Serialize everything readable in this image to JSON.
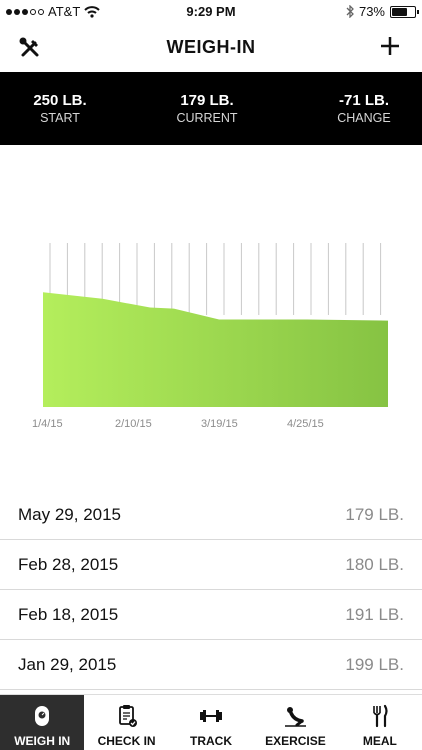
{
  "status": {
    "carrier": "AT&T",
    "time": "9:29 PM",
    "battery": "73%",
    "battery_level": 0.73
  },
  "header": {
    "title": "WEIGH-IN"
  },
  "stats": [
    {
      "value": "250 LB.",
      "label": "START"
    },
    {
      "value": "179 LB.",
      "label": "CURRENT"
    },
    {
      "value": "-71 LB.",
      "label": "CHANGE"
    }
  ],
  "chart_data": {
    "type": "area",
    "x_tick_labels": [
      "1/4/15",
      "2/10/15",
      "3/19/15",
      "4/25/15"
    ],
    "x": [
      "2015-01-04",
      "2015-01-29",
      "2015-02-18",
      "2015-02-28",
      "2015-03-19",
      "2015-04-25",
      "2015-05-29"
    ],
    "values": [
      205,
      199,
      191,
      190,
      180,
      180,
      179
    ],
    "ylim": [
      100,
      250
    ],
    "grid": true,
    "fill_colors": [
      "#b4ee5c",
      "#86c343"
    ]
  },
  "entries": [
    {
      "date": "May 29, 2015",
      "weight": "179 LB."
    },
    {
      "date": "Feb 28, 2015",
      "weight": "180 LB."
    },
    {
      "date": "Feb 18, 2015",
      "weight": "191 LB."
    },
    {
      "date": "Jan 29, 2015",
      "weight": "199 LB."
    }
  ],
  "tabs": [
    {
      "label": "WEIGH IN",
      "icon": "scale-icon",
      "active": true
    },
    {
      "label": "CHECK IN",
      "icon": "clipboard-check-icon",
      "active": false
    },
    {
      "label": "TRACK",
      "icon": "dumbbell-icon",
      "active": false
    },
    {
      "label": "EXERCISE",
      "icon": "situp-icon",
      "active": false
    },
    {
      "label": "MEAL",
      "icon": "fork-knife-icon",
      "active": false
    }
  ]
}
